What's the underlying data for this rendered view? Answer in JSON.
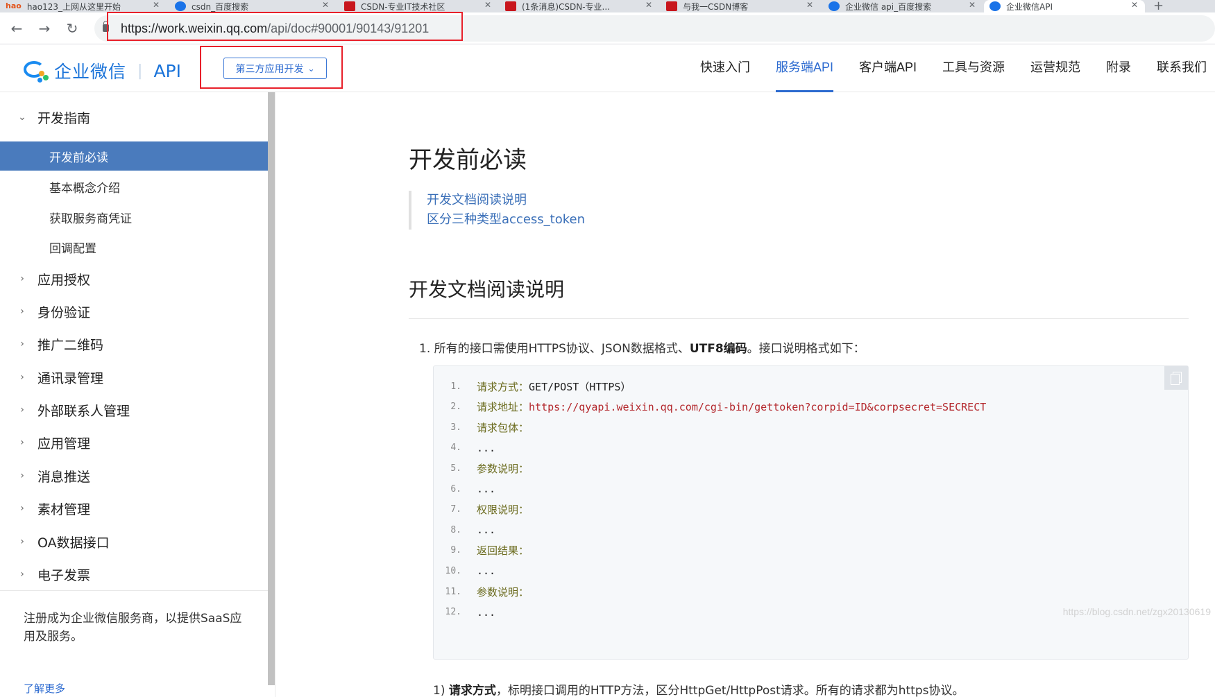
{
  "browser": {
    "tabs": [
      {
        "label": "hao123_上网从这里开始"
      },
      {
        "label": "csdn_百度搜索"
      },
      {
        "label": "CSDN-专业IT技术社区"
      },
      {
        "label": "(1条消息)CSDN-专业..."
      },
      {
        "label": "与我一CSDN博客"
      },
      {
        "label": "企业微信 api_百度搜索"
      },
      {
        "label": "企业微信API"
      }
    ],
    "tab_close": "✕",
    "new_tab": "+",
    "back_icon": "←",
    "forward_icon": "→",
    "reload_icon": "↻",
    "url_host": "https://work.weixin.qq.com",
    "url_path": "/api/doc#90001/90143/91201"
  },
  "header": {
    "brand": "企业微信",
    "separator": "|",
    "api": "API",
    "app_dropdown": "第三方应用开发",
    "dropdown_chevron": "⌄",
    "nav": [
      {
        "label": "快速入门"
      },
      {
        "label": "服务端API"
      },
      {
        "label": "客户端API"
      },
      {
        "label": "工具与资源"
      },
      {
        "label": "运营规范"
      },
      {
        "label": "附录"
      },
      {
        "label": "联系我们"
      }
    ]
  },
  "sidebar": {
    "group_open": {
      "label": "开发指南",
      "arrow": "⌄"
    },
    "subitems": [
      {
        "label": "开发前必读"
      },
      {
        "label": "基本概念介绍"
      },
      {
        "label": "获取服务商凭证"
      },
      {
        "label": "回调配置"
      }
    ],
    "groups": [
      {
        "label": "应用授权"
      },
      {
        "label": "身份验证"
      },
      {
        "label": "推广二维码"
      },
      {
        "label": "通讯录管理"
      },
      {
        "label": "外部联系人管理"
      },
      {
        "label": "应用管理"
      },
      {
        "label": "消息推送"
      },
      {
        "label": "素材管理"
      },
      {
        "label": "OA数据接口"
      },
      {
        "label": "电子发票"
      }
    ],
    "collapsed_arrow": "›",
    "promo": "注册成为企业微信服务商，以提供SaaS应用及服务。",
    "learn_more": "了解更多"
  },
  "content": {
    "title": "开发前必读",
    "toc": [
      {
        "label": "开发文档阅读说明"
      },
      {
        "label": "区分三种类型access_token"
      }
    ],
    "section_title": "开发文档阅读说明",
    "para1_prefix": "1. 所有的接口需使用HTTPS协议、JSON数据格式、",
    "para1_bold": "UTF8编码",
    "para1_suffix": "。接口说明格式如下：",
    "code_lines": [
      {
        "num": "1.",
        "label": "请求方式：",
        "value": "GET/POST（HTTPS）"
      },
      {
        "num": "2.",
        "label": "请求地址：",
        "value": "https://qyapi.weixin.qq.com/cgi-bin/gettoken?corpid=ID&corpsecret=SECRECT"
      },
      {
        "num": "3.",
        "label": "请求包体：",
        "value": ""
      },
      {
        "num": "4.",
        "label": "",
        "value": "..."
      },
      {
        "num": "5.",
        "label": "参数说明：",
        "value": ""
      },
      {
        "num": "6.",
        "label": "",
        "value": "..."
      },
      {
        "num": "7.",
        "label": "权限说明：",
        "value": ""
      },
      {
        "num": "8.",
        "label": "",
        "value": "..."
      },
      {
        "num": "9.",
        "label": "返回结果：",
        "value": ""
      },
      {
        "num": "10.",
        "label": "",
        "value": "..."
      },
      {
        "num": "11.",
        "label": "参数说明：",
        "value": ""
      },
      {
        "num": "12.",
        "label": "",
        "value": "..."
      }
    ],
    "para2_prefix": "1) ",
    "para2_bold": "请求方式",
    "para2_suffix": "，标明接口调用的HTTP方法，区分HttpGet/HttpPost请求。所有的请求都为https协议。",
    "watermark": "https://blog.csdn.net/zgx20130619"
  },
  "colors": {
    "accent": "#2d6bd0",
    "sidebar_active": "#4a7bbd",
    "highlight_box": "#e8202a"
  }
}
